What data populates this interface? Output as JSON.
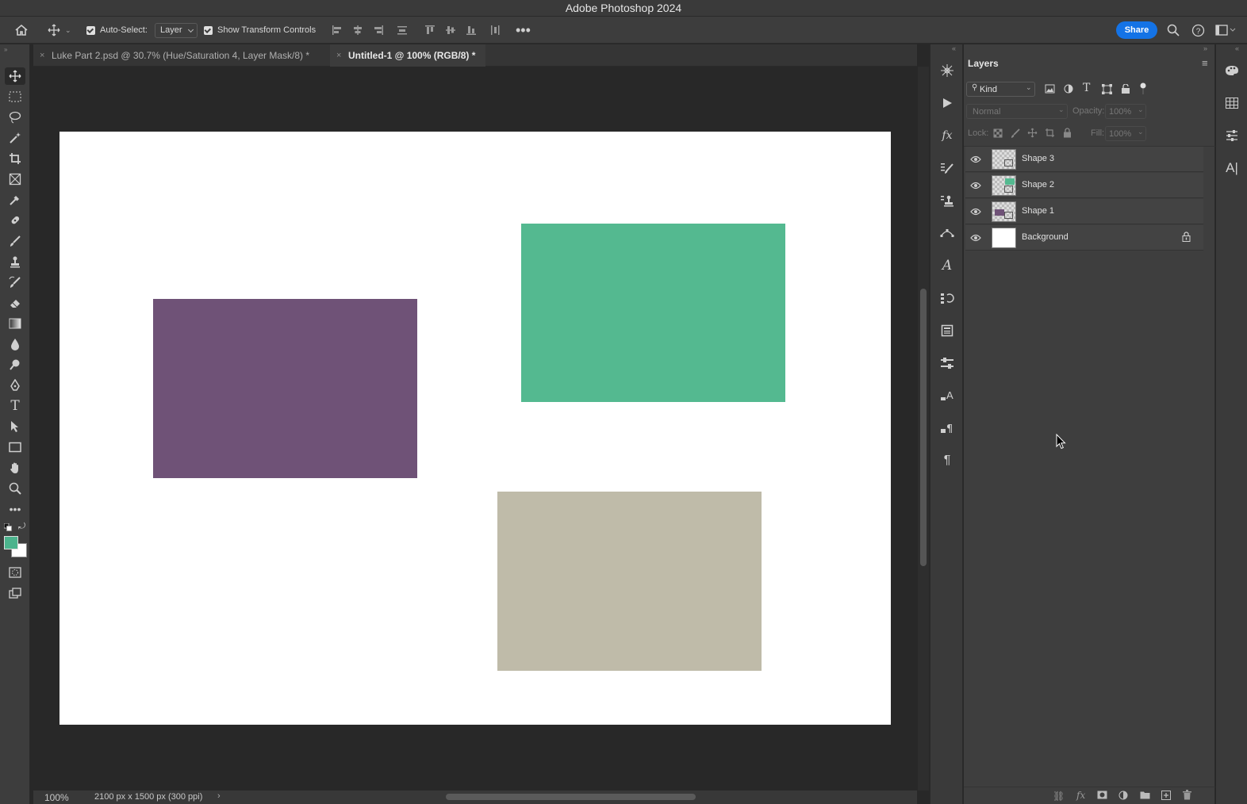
{
  "app": {
    "title": "Adobe Photoshop 2024"
  },
  "options_bar": {
    "auto_select_label": "Auto-Select:",
    "auto_select_value": "Layer",
    "show_transform_label": "Show Transform Controls",
    "share_label": "Share"
  },
  "tabs": [
    {
      "label": "Luke Part 2.psd @ 30.7% (Hue/Saturation 4, Layer Mask/8) *",
      "active": false
    },
    {
      "label": "Untitled-1 @ 100% (RGB/8) *",
      "active": true
    }
  ],
  "canvas": {
    "shapes": [
      {
        "name": "purple-rectangle",
        "color": "#6f5277"
      },
      {
        "name": "green-rectangle",
        "color": "#54b990"
      },
      {
        "name": "beige-rectangle",
        "color": "#bfbba9"
      }
    ]
  },
  "status": {
    "zoom": "100%",
    "doc_info": "2100 px x 1500 px (300 ppi)"
  },
  "colors": {
    "foreground": "#4cb38d",
    "background": "#ffffff",
    "accent": "#1473e6"
  },
  "layers_panel": {
    "title": "Layers",
    "filter_kind": "Kind",
    "blend_mode": "Normal",
    "opacity_label": "Opacity:",
    "opacity_value": "100%",
    "lock_label": "Lock:",
    "fill_label": "Fill:",
    "fill_value": "100%",
    "layers": [
      {
        "name": "Shape 3",
        "locked": false,
        "thumb_color": "#bfbba9"
      },
      {
        "name": "Shape 2",
        "locked": false,
        "thumb_color": "#54b990"
      },
      {
        "name": "Shape 1",
        "locked": false,
        "thumb_color": "#6f5277"
      },
      {
        "name": "Background",
        "locked": true,
        "thumb_color": "#ffffff"
      }
    ]
  }
}
